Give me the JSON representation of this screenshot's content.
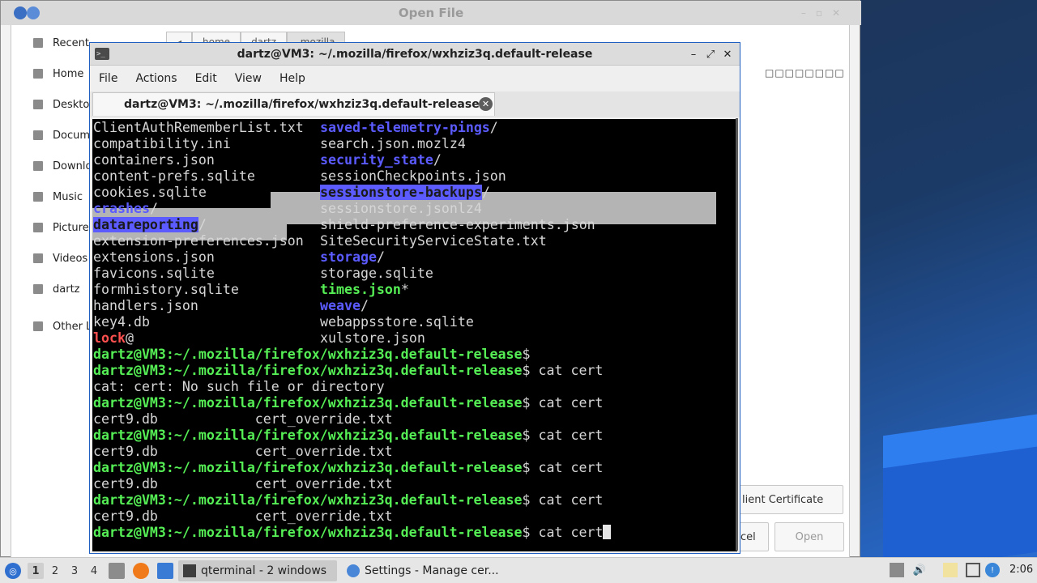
{
  "dialog": {
    "title": "Open File",
    "sidebar": [
      "Recent",
      "Home",
      "Deskto",
      "Docum",
      "Downlo",
      "Music",
      "Picture",
      "Videos",
      "dartz",
      "Other L"
    ],
    "path": [
      "home",
      "dartz",
      ".mozilla"
    ],
    "placeholder_glyphs": "□□□□□□□□",
    "client_cert_button": "lient Certificate",
    "cancel_button": "cel",
    "open_button": "Open"
  },
  "terminal": {
    "title": "dartz@VM3: ~/.mozilla/firefox/wxhziz3q.default-release",
    "menu": [
      "File",
      "Actions",
      "Edit",
      "View",
      "Help"
    ],
    "tab_label": "dartz@VM3: ~/.mozilla/firefox/wxhziz3q.default-release",
    "listing": [
      {
        "left": "ClientAuthRememberList.txt",
        "left_style": "plain",
        "right": "saved-telemetry-pings",
        "right_style": "dir"
      },
      {
        "left": "compatibility.ini",
        "left_style": "plain",
        "right": "search.json.mozlz4",
        "right_style": "plain"
      },
      {
        "left": "containers.json",
        "left_style": "plain",
        "right": "security_state",
        "right_style": "dir"
      },
      {
        "left": "content-prefs.sqlite",
        "left_style": "plain",
        "right": "sessionCheckpoints.json",
        "right_style": "plain"
      },
      {
        "left": "cookies.sqlite",
        "left_style": "plain",
        "right": "sessionstore-backups",
        "right_style": "dir-sel"
      },
      {
        "left": "crashes",
        "left_style": "dir",
        "right": "sessionstore.jsonlz4",
        "right_style": "plain"
      },
      {
        "left": "datareporting",
        "left_style": "dir-sel",
        "right": "shield-preference-experiments.json",
        "right_style": "plain"
      },
      {
        "left": "extension-preferences.json",
        "left_style": "plain",
        "right": "SiteSecurityServiceState.txt",
        "right_style": "plain"
      },
      {
        "left": "extensions.json",
        "left_style": "plain",
        "right": "storage",
        "right_style": "dir"
      },
      {
        "left": "favicons.sqlite",
        "left_style": "plain",
        "right": "storage.sqlite",
        "right_style": "plain"
      },
      {
        "left": "formhistory.sqlite",
        "left_style": "plain",
        "right": "times.json",
        "right_style": "exec"
      },
      {
        "left": "handlers.json",
        "left_style": "plain",
        "right": "weave",
        "right_style": "dir"
      },
      {
        "left": "key4.db",
        "left_style": "plain",
        "right": "webappsstore.sqlite",
        "right_style": "plain"
      },
      {
        "left": "lock",
        "left_style": "link",
        "right": "xulstore.json",
        "right_style": "plain"
      }
    ],
    "prompt": "dartz@VM3:~/.mozilla/firefox/wxhziz3q.default-release$",
    "history": [
      {
        "prompt_cmd": "",
        "output": ""
      },
      {
        "prompt_cmd": " cat cert",
        "output": "cat: cert: No such file or directory"
      },
      {
        "prompt_cmd": " cat cert",
        "output": "cert9.db            cert_override.txt"
      },
      {
        "prompt_cmd": " cat cert",
        "output": "cert9.db            cert_override.txt"
      },
      {
        "prompt_cmd": " cat cert",
        "output": "cert9.db            cert_override.txt"
      },
      {
        "prompt_cmd": " cat cert",
        "output": "cert9.db            cert_override.txt"
      },
      {
        "prompt_cmd": " cat cert",
        "output": ""
      }
    ]
  },
  "taskbar": {
    "workspaces": [
      "1",
      "2",
      "3",
      "4"
    ],
    "task_terminal": "qterminal - 2 windows",
    "task_settings": "Settings - Manage cer...",
    "clock": "2:06"
  }
}
